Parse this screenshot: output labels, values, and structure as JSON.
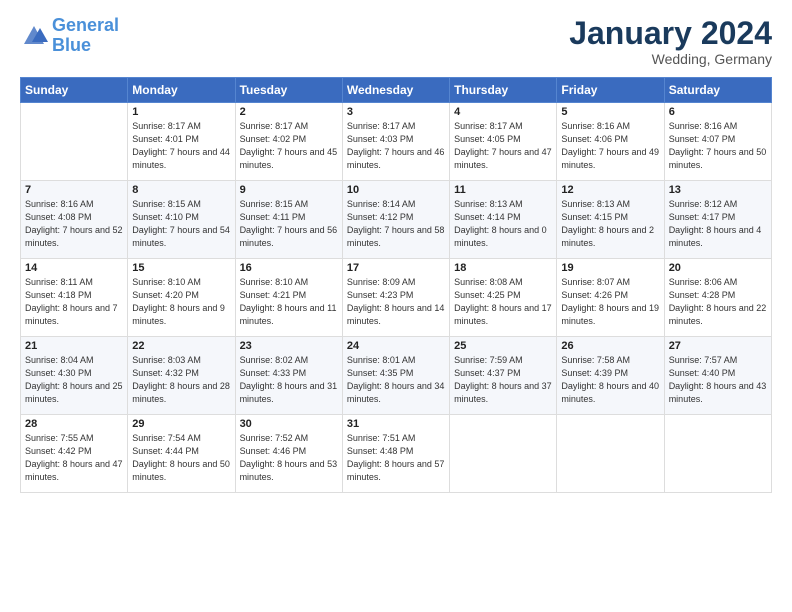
{
  "header": {
    "logo_line1": "General",
    "logo_line2": "Blue",
    "month": "January 2024",
    "location": "Wedding, Germany"
  },
  "days_of_week": [
    "Sunday",
    "Monday",
    "Tuesday",
    "Wednesday",
    "Thursday",
    "Friday",
    "Saturday"
  ],
  "weeks": [
    [
      {
        "num": "",
        "sunrise": "",
        "sunset": "",
        "daylight": ""
      },
      {
        "num": "1",
        "sunrise": "Sunrise: 8:17 AM",
        "sunset": "Sunset: 4:01 PM",
        "daylight": "Daylight: 7 hours and 44 minutes."
      },
      {
        "num": "2",
        "sunrise": "Sunrise: 8:17 AM",
        "sunset": "Sunset: 4:02 PM",
        "daylight": "Daylight: 7 hours and 45 minutes."
      },
      {
        "num": "3",
        "sunrise": "Sunrise: 8:17 AM",
        "sunset": "Sunset: 4:03 PM",
        "daylight": "Daylight: 7 hours and 46 minutes."
      },
      {
        "num": "4",
        "sunrise": "Sunrise: 8:17 AM",
        "sunset": "Sunset: 4:05 PM",
        "daylight": "Daylight: 7 hours and 47 minutes."
      },
      {
        "num": "5",
        "sunrise": "Sunrise: 8:16 AM",
        "sunset": "Sunset: 4:06 PM",
        "daylight": "Daylight: 7 hours and 49 minutes."
      },
      {
        "num": "6",
        "sunrise": "Sunrise: 8:16 AM",
        "sunset": "Sunset: 4:07 PM",
        "daylight": "Daylight: 7 hours and 50 minutes."
      }
    ],
    [
      {
        "num": "7",
        "sunrise": "Sunrise: 8:16 AM",
        "sunset": "Sunset: 4:08 PM",
        "daylight": "Daylight: 7 hours and 52 minutes."
      },
      {
        "num": "8",
        "sunrise": "Sunrise: 8:15 AM",
        "sunset": "Sunset: 4:10 PM",
        "daylight": "Daylight: 7 hours and 54 minutes."
      },
      {
        "num": "9",
        "sunrise": "Sunrise: 8:15 AM",
        "sunset": "Sunset: 4:11 PM",
        "daylight": "Daylight: 7 hours and 56 minutes."
      },
      {
        "num": "10",
        "sunrise": "Sunrise: 8:14 AM",
        "sunset": "Sunset: 4:12 PM",
        "daylight": "Daylight: 7 hours and 58 minutes."
      },
      {
        "num": "11",
        "sunrise": "Sunrise: 8:13 AM",
        "sunset": "Sunset: 4:14 PM",
        "daylight": "Daylight: 8 hours and 0 minutes."
      },
      {
        "num": "12",
        "sunrise": "Sunrise: 8:13 AM",
        "sunset": "Sunset: 4:15 PM",
        "daylight": "Daylight: 8 hours and 2 minutes."
      },
      {
        "num": "13",
        "sunrise": "Sunrise: 8:12 AM",
        "sunset": "Sunset: 4:17 PM",
        "daylight": "Daylight: 8 hours and 4 minutes."
      }
    ],
    [
      {
        "num": "14",
        "sunrise": "Sunrise: 8:11 AM",
        "sunset": "Sunset: 4:18 PM",
        "daylight": "Daylight: 8 hours and 7 minutes."
      },
      {
        "num": "15",
        "sunrise": "Sunrise: 8:10 AM",
        "sunset": "Sunset: 4:20 PM",
        "daylight": "Daylight: 8 hours and 9 minutes."
      },
      {
        "num": "16",
        "sunrise": "Sunrise: 8:10 AM",
        "sunset": "Sunset: 4:21 PM",
        "daylight": "Daylight: 8 hours and 11 minutes."
      },
      {
        "num": "17",
        "sunrise": "Sunrise: 8:09 AM",
        "sunset": "Sunset: 4:23 PM",
        "daylight": "Daylight: 8 hours and 14 minutes."
      },
      {
        "num": "18",
        "sunrise": "Sunrise: 8:08 AM",
        "sunset": "Sunset: 4:25 PM",
        "daylight": "Daylight: 8 hours and 17 minutes."
      },
      {
        "num": "19",
        "sunrise": "Sunrise: 8:07 AM",
        "sunset": "Sunset: 4:26 PM",
        "daylight": "Daylight: 8 hours and 19 minutes."
      },
      {
        "num": "20",
        "sunrise": "Sunrise: 8:06 AM",
        "sunset": "Sunset: 4:28 PM",
        "daylight": "Daylight: 8 hours and 22 minutes."
      }
    ],
    [
      {
        "num": "21",
        "sunrise": "Sunrise: 8:04 AM",
        "sunset": "Sunset: 4:30 PM",
        "daylight": "Daylight: 8 hours and 25 minutes."
      },
      {
        "num": "22",
        "sunrise": "Sunrise: 8:03 AM",
        "sunset": "Sunset: 4:32 PM",
        "daylight": "Daylight: 8 hours and 28 minutes."
      },
      {
        "num": "23",
        "sunrise": "Sunrise: 8:02 AM",
        "sunset": "Sunset: 4:33 PM",
        "daylight": "Daylight: 8 hours and 31 minutes."
      },
      {
        "num": "24",
        "sunrise": "Sunrise: 8:01 AM",
        "sunset": "Sunset: 4:35 PM",
        "daylight": "Daylight: 8 hours and 34 minutes."
      },
      {
        "num": "25",
        "sunrise": "Sunrise: 7:59 AM",
        "sunset": "Sunset: 4:37 PM",
        "daylight": "Daylight: 8 hours and 37 minutes."
      },
      {
        "num": "26",
        "sunrise": "Sunrise: 7:58 AM",
        "sunset": "Sunset: 4:39 PM",
        "daylight": "Daylight: 8 hours and 40 minutes."
      },
      {
        "num": "27",
        "sunrise": "Sunrise: 7:57 AM",
        "sunset": "Sunset: 4:40 PM",
        "daylight": "Daylight: 8 hours and 43 minutes."
      }
    ],
    [
      {
        "num": "28",
        "sunrise": "Sunrise: 7:55 AM",
        "sunset": "Sunset: 4:42 PM",
        "daylight": "Daylight: 8 hours and 47 minutes."
      },
      {
        "num": "29",
        "sunrise": "Sunrise: 7:54 AM",
        "sunset": "Sunset: 4:44 PM",
        "daylight": "Daylight: 8 hours and 50 minutes."
      },
      {
        "num": "30",
        "sunrise": "Sunrise: 7:52 AM",
        "sunset": "Sunset: 4:46 PM",
        "daylight": "Daylight: 8 hours and 53 minutes."
      },
      {
        "num": "31",
        "sunrise": "Sunrise: 7:51 AM",
        "sunset": "Sunset: 4:48 PM",
        "daylight": "Daylight: 8 hours and 57 minutes."
      },
      {
        "num": "",
        "sunrise": "",
        "sunset": "",
        "daylight": ""
      },
      {
        "num": "",
        "sunrise": "",
        "sunset": "",
        "daylight": ""
      },
      {
        "num": "",
        "sunrise": "",
        "sunset": "",
        "daylight": ""
      }
    ]
  ]
}
